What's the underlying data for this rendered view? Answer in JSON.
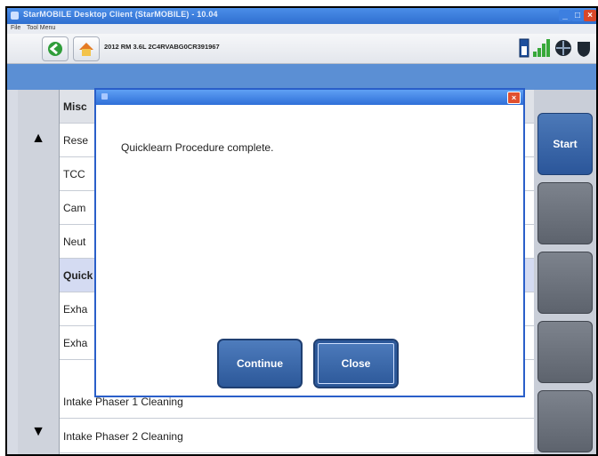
{
  "window": {
    "title": "StarMOBILE Desktop Client (StarMOBILE) - 10.04",
    "menu": [
      "File",
      "Tool Menu"
    ]
  },
  "toolbar": {
    "vehicle_info": "2012 RM 3.6L 2C4RVABG0CR391967",
    "icons": [
      "back-icon",
      "home-icon",
      "battery-icon",
      "signal-icon",
      "network-icon",
      "shield-icon"
    ]
  },
  "list": {
    "header": "Misc",
    "rows": [
      "Rese",
      "TCC",
      "Cam",
      "Neut",
      "Quick",
      "Exha",
      "Exha",
      "Intake Phaser 1 Cleaning",
      "Intake Phaser 2 Cleaning"
    ]
  },
  "right_panel": {
    "start_label": "Start"
  },
  "dialog": {
    "message": "Quicklearn Procedure complete.",
    "continue_label": "Continue",
    "close_label": "Close"
  },
  "colors": {
    "title_blue": "#2f6fd0",
    "band_blue": "#5b8fd4",
    "button_blue": "#2c5899",
    "close_red": "#e0502f"
  }
}
